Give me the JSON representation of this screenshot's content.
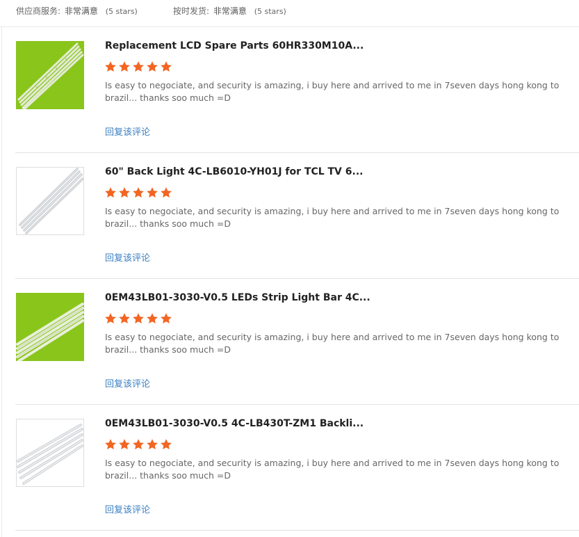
{
  "ratings": {
    "supplier_service": {
      "label": "供应商服务:",
      "value": "非常满意",
      "stars_text": "(5 stars)"
    },
    "on_time_shipping": {
      "label": "按时发货:",
      "value": "非常满意",
      "stars_text": "(5 stars)"
    }
  },
  "reviews": [
    {
      "title": "Replacement LCD Spare Parts 60HR330M10A...",
      "rating": 5,
      "comment": "Is easy to negociate, and security is amazing, i buy here and arrived to me in 7seven days hong kong to brazil... thanks soo much =D",
      "reply_label": "回复该评论",
      "thumb_icon": "led-strip-bars-on-green-thumbnail"
    },
    {
      "title": "60\" Back Light 4C-LB6010-YH01J for TCL TV 6...",
      "rating": 5,
      "comment": "Is easy to negociate, and security is amazing, i buy here and arrived to me in 7seven days hong kong to brazil... thanks soo much =D",
      "reply_label": "回复该评论",
      "thumb_icon": "led-strip-bars-on-white-thumbnail"
    },
    {
      "title": "0EM43LB01-3030-V0.5 LEDs Strip Light Bar 4C...",
      "rating": 5,
      "comment": "Is easy to negociate, and security is amazing, i buy here and arrived to me in 7seven days hong kong to brazil... thanks soo much =D",
      "reply_label": "回复该评论",
      "thumb_icon": "led-strip-bars-on-green-thumbnail"
    },
    {
      "title": "0EM43LB01-3030-V0.5 4C-LB430T-ZM1 Backli...",
      "rating": 5,
      "comment": "Is easy to negociate, and security is amazing, i buy here and arrived to me in 7seven days hong kong to brazil... thanks soo much =D",
      "reply_label": "回复该评论",
      "thumb_icon": "led-strip-bars-on-white-thumbnail"
    }
  ],
  "colors": {
    "star": "#f26522",
    "reply_link": "#3a7fc1",
    "thumb_green": "#8ac51c"
  }
}
